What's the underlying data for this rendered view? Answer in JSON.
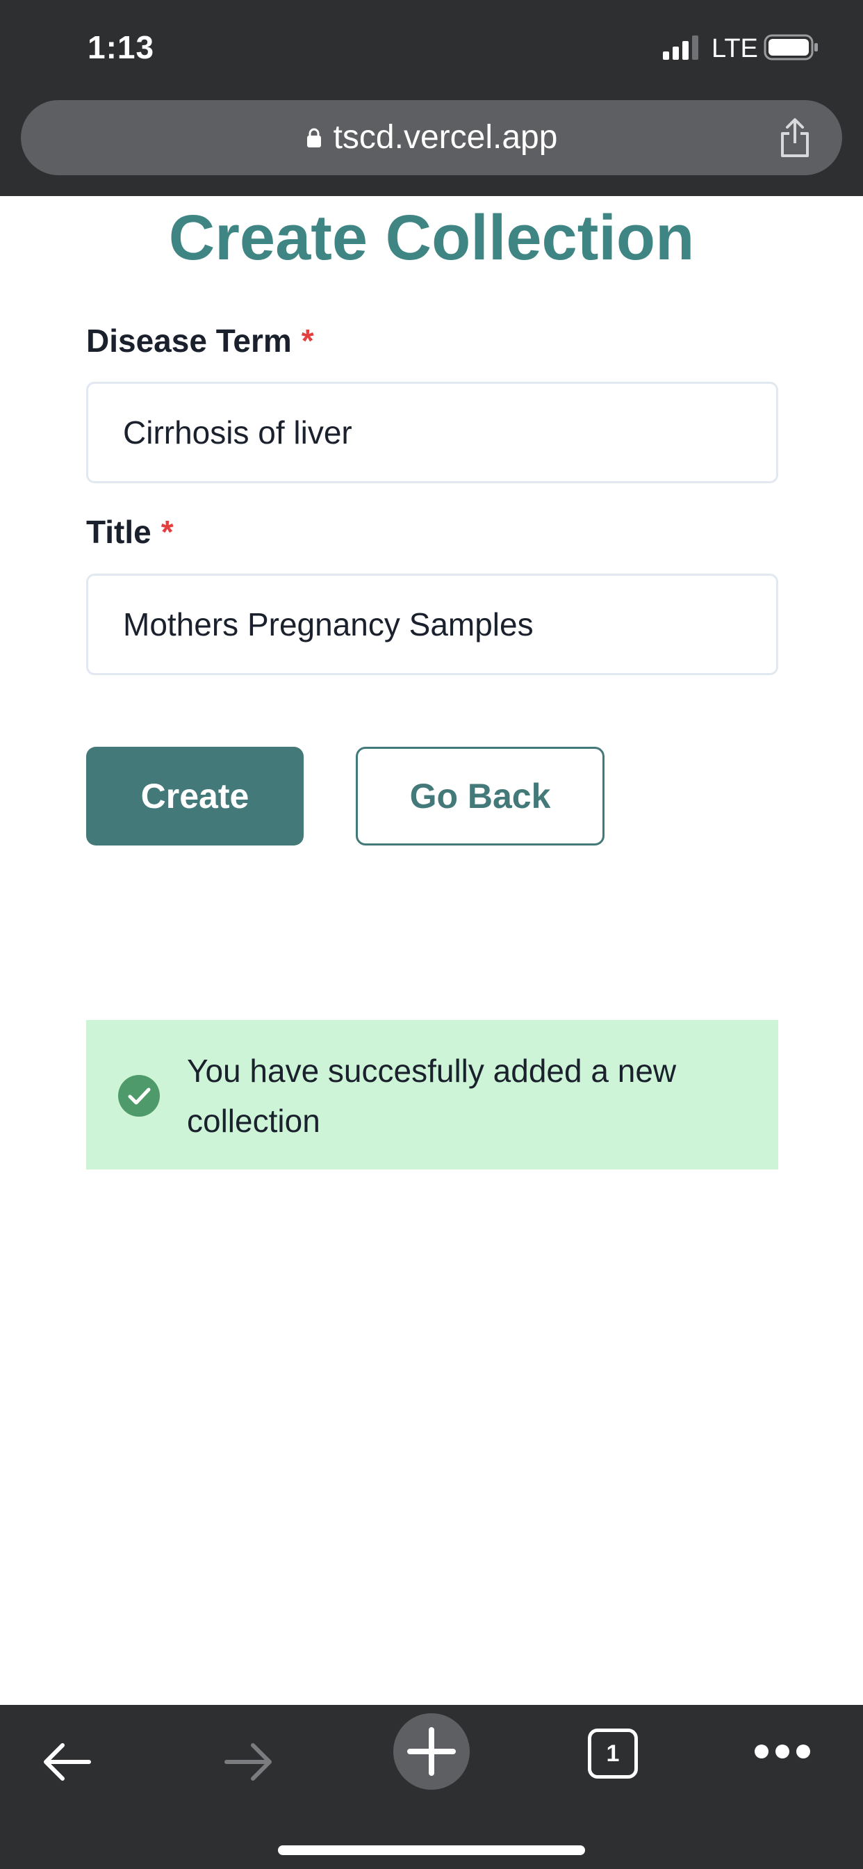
{
  "status_bar": {
    "time": "1:13",
    "network": "LTE"
  },
  "browser": {
    "url": "tscd.vercel.app",
    "tab_count": "1"
  },
  "page": {
    "title": "Create Collection",
    "fields": {
      "disease_term": {
        "label": "Disease Term",
        "required_mark": "*",
        "value": "Cirrhosis of liver"
      },
      "title": {
        "label": "Title",
        "required_mark": "*",
        "value": "Mothers Pregnancy Samples"
      }
    },
    "buttons": {
      "create": "Create",
      "go_back": "Go Back"
    },
    "alert": {
      "message": "You have succesfully added a new collection",
      "status": "success"
    }
  },
  "colors": {
    "accent": "#44797a",
    "title": "#3e8583",
    "required": "#e53e3e",
    "alert_bg": "#cdf4d7",
    "alert_icon": "#4e9a6a",
    "browser_chrome": "#2e2f31"
  },
  "icons": [
    "lock-icon",
    "share-icon",
    "back-arrow-icon",
    "forward-arrow-icon",
    "new-tab-icon",
    "tabs-icon",
    "more-icon",
    "check-circle-icon",
    "signal-icon",
    "battery-icon"
  ]
}
